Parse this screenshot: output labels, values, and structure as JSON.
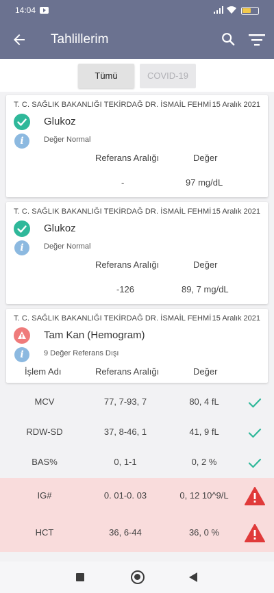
{
  "status_bar": {
    "time": "14:04",
    "battery_level": 0.55
  },
  "header": {
    "title": "Tahlillerim"
  },
  "segments": {
    "all": "Tümü",
    "covid": "COVID-19"
  },
  "cards": [
    {
      "hospital": "T. C.  SAĞLIK BAKANLIĞI TEKİRDAĞ DR.  İSMAİL FEHMİ",
      "date": "15 Aralık 2021",
      "test": "Glukoz",
      "status": "ok",
      "note": "Değer Normal",
      "ref_label": "Referans Aralığı",
      "val_label": "Değer",
      "ref": "-",
      "value": "97 mg/dL"
    },
    {
      "hospital": "T. C.  SAĞLIK BAKANLIĞI TEKİRDAĞ DR.  İSMAİL FEHMİ",
      "date": "15 Aralık 2021",
      "test": "Glukoz",
      "status": "ok",
      "note": "Değer Normal",
      "ref_label": "Referans Aralığı",
      "val_label": "Değer",
      "ref": "-126",
      "value": "89, 7 mg/dL"
    },
    {
      "hospital": "T. C.  SAĞLIK BAKANLIĞI TEKİRDAĞ DR.  İSMAİL FEHMİ",
      "date": "15 Aralık 2021",
      "test": "Tam Kan (Hemogram)",
      "status": "warning",
      "note": "9 Değer Referans Dışı",
      "name_label": "İşlem Adı",
      "ref_label": "Referans Aralığı",
      "val_label": "Değer"
    }
  ],
  "results": [
    {
      "name": "MCV",
      "ref": "77, 7-93, 7",
      "value": "80, 4 fL",
      "status": "ok"
    },
    {
      "name": "RDW-SD",
      "ref": "37, 8-46, 1",
      "value": "41, 9 fL",
      "status": "ok"
    },
    {
      "name": "BAS%",
      "ref": "0, 1-1",
      "value": "0, 2 %",
      "status": "ok"
    },
    {
      "name": "IG#",
      "ref": "0. 01-0. 03",
      "value": "0, 12 10^9/L",
      "status": "alert"
    },
    {
      "name": "HCT",
      "ref": "36, 6-44",
      "value": "36, 0 %",
      "status": "alert"
    }
  ],
  "icons": {
    "ok_color": "#2fb89a",
    "warn_color": "#ef7b7b",
    "info_color": "#8cb9e0",
    "alert_bg": "#f9dcdc",
    "bar_color": "#6b7290"
  }
}
